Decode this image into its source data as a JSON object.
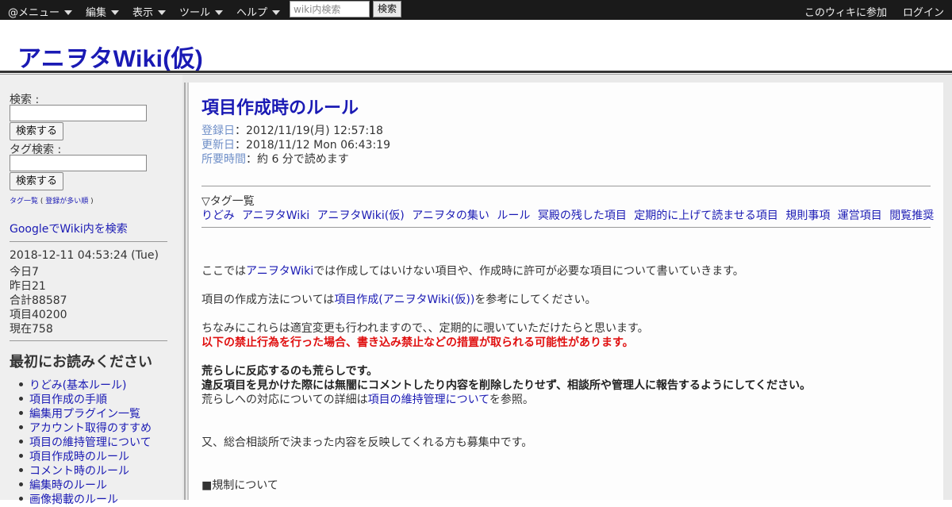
{
  "topbar": {
    "menu_items": [
      {
        "label": "@メニュー"
      },
      {
        "label": "編集"
      },
      {
        "label": "表示"
      },
      {
        "label": "ツール"
      },
      {
        "label": "ヘルプ"
      }
    ],
    "search_placeholder": "wiki内検索",
    "search_button": "検索",
    "join_label": "このウィキに参加",
    "login_label": "ログイン"
  },
  "site": {
    "title": "アニヲタWiki(仮)"
  },
  "sidebar": {
    "search_label": "検索 :",
    "search_button": "検索する",
    "tag_search_label": "タグ検索 :",
    "tag_search_button": "検索する",
    "tag_list_label": "タグ一覧",
    "tag_list_sort_label": "登録が多い順",
    "google_link": "GoogleでWiki内を検索",
    "stats": {
      "datetime": "2018-12-11 04:53:24 (Tue)",
      "today": "今日7",
      "yesterday": "昨日21",
      "total": "合計88587",
      "items": "項目40200",
      "online": "現在758"
    },
    "readme_heading": "最初にお読みください",
    "readme_items": [
      {
        "label": "りどみ(基本ルール)"
      },
      {
        "label": "項目作成の手順"
      },
      {
        "label": "編集用プラグイン一覧"
      },
      {
        "label": "アカウント取得のすすめ"
      },
      {
        "label": "項目の維持管理について"
      },
      {
        "label": "項目作成時のルール"
      },
      {
        "label": "コメント時のルール"
      },
      {
        "label": "編集時のルール"
      },
      {
        "label": "画像掲載のルール"
      }
    ]
  },
  "page": {
    "title": "項目作成時のルール",
    "registered_label": "登録日",
    "registered_value": "：2012/11/19(月) 12:57:18",
    "updated_label": "更新日",
    "updated_value": "：2018/11/12 Mon 06:43:19",
    "read_time_label": "所要時間",
    "read_time_value": "：約 6 分で読めます",
    "tags_title": "▽タグ一覧",
    "tags": [
      {
        "label": "りどみ"
      },
      {
        "label": "アニヲタWiki"
      },
      {
        "label": "アニヲタWiki(仮)"
      },
      {
        "label": "アニヲタの集い"
      },
      {
        "label": "ルール"
      },
      {
        "label": "冥殿の残した項目"
      },
      {
        "label": "定期的に上げて読ませる項目"
      },
      {
        "label": "規則事項"
      },
      {
        "label": "運営項目"
      },
      {
        "label": "閲覧推奨"
      }
    ],
    "body": {
      "p1_pre": "ここでは",
      "p1_link": "アニヲタWiki",
      "p1_post": "では作成してはいけない項目や、作成時に許可が必要な項目について書いていきます。",
      "p2_pre": "項目の作成方法については",
      "p2_link": "項目作成(アニヲタWiki(仮))",
      "p2_post": "を参考にしてください。",
      "p3": "ちなみにこれらは適宜変更も行われますので、、定期的に覗いていただけたらと思います。",
      "p3_warning": "以下の禁止行為を行った場合、書き込み禁止などの措置が取られる可能性があります。",
      "p4_bold1": "荒らしに反応するのも荒らしです。",
      "p4_bold2": "違反項目を見かけた際には無闇にコメントしたり内容を削除したりせず、相談所や管理人に報告するようにしてください。",
      "p4_pre": "荒らしへの対応についての詳細は",
      "p4_link": "項目の維持管理について",
      "p4_post": "を参照。",
      "p5": "又、総合相談所で決まった内容を反映してくれる方も募集中です。",
      "p6": "■規制について"
    }
  }
}
